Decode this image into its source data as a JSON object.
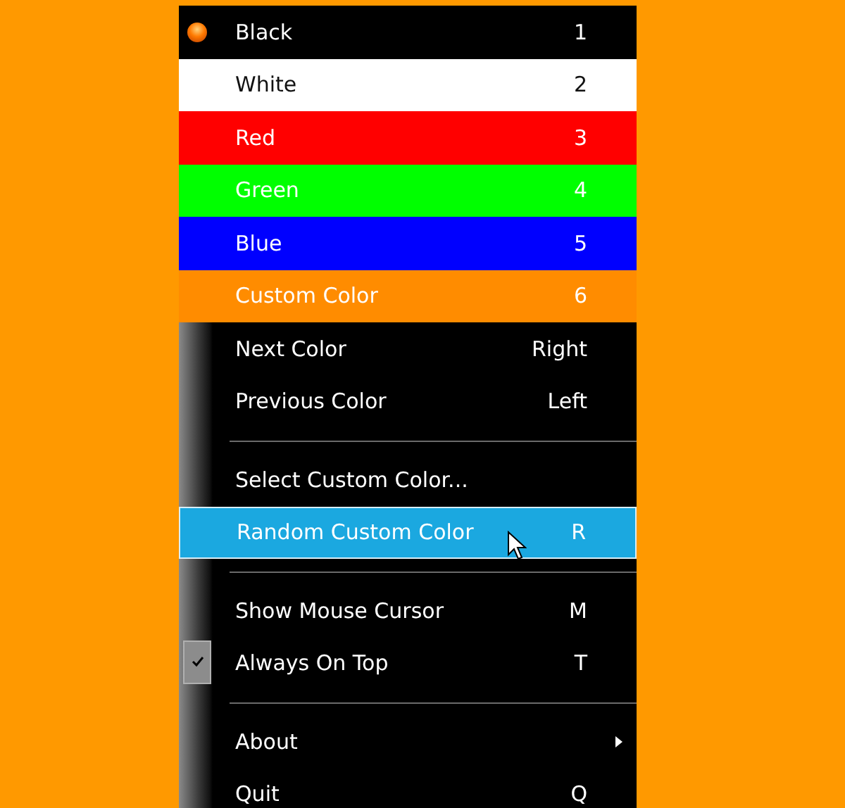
{
  "menu": {
    "items": [
      {
        "kind": "color",
        "label": "Black",
        "shortcut": "1",
        "color": "#000000",
        "selected": true
      },
      {
        "kind": "color",
        "label": "White",
        "shortcut": "2",
        "color": "#ffffff",
        "selected": false
      },
      {
        "kind": "color",
        "label": "Red",
        "shortcut": "3",
        "color": "#ff0000",
        "selected": false
      },
      {
        "kind": "color",
        "label": "Green",
        "shortcut": "4",
        "color": "#00ff00",
        "selected": false
      },
      {
        "kind": "color",
        "label": "Blue",
        "shortcut": "5",
        "color": "#0000ff",
        "selected": false
      },
      {
        "kind": "color",
        "label": "Custom Color",
        "shortcut": "6",
        "color": "#ff8c00",
        "selected": false
      },
      {
        "kind": "command",
        "label": "Next Color",
        "shortcut": "Right",
        "highlighted": false
      },
      {
        "kind": "command",
        "label": "Previous Color",
        "shortcut": "Left",
        "highlighted": false
      },
      {
        "kind": "separator"
      },
      {
        "kind": "command",
        "label": "Select Custom Color...",
        "highlighted": false
      },
      {
        "kind": "command",
        "label": "Random Custom Color",
        "shortcut": "R",
        "highlighted": true
      },
      {
        "kind": "separator"
      },
      {
        "kind": "check",
        "label": "Show Mouse Cursor",
        "shortcut": "M",
        "checked": false
      },
      {
        "kind": "check",
        "label": "Always On Top",
        "shortcut": "T",
        "checked": true
      },
      {
        "kind": "separator"
      },
      {
        "kind": "submenu",
        "label": "About"
      },
      {
        "kind": "command",
        "label": "Quit",
        "shortcut": "Q",
        "highlighted": false
      }
    ]
  }
}
